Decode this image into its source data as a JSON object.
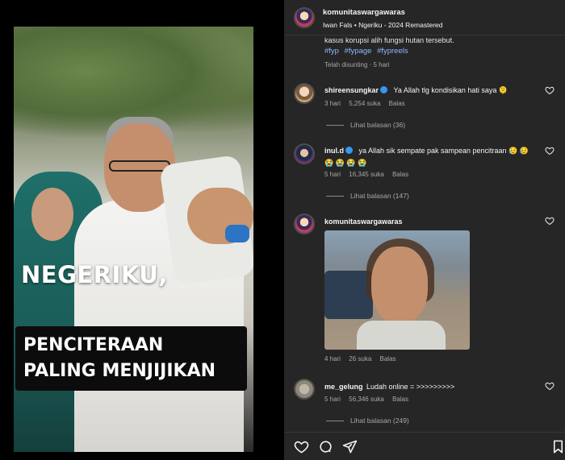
{
  "video": {
    "overlay_title": "NEGERIKU,",
    "overlay_line1": "PENCITERAAN",
    "overlay_line2": "PALING MENJIJIKAN"
  },
  "post": {
    "username": "komunitaswargawaras",
    "audio": "Iwan Fals • Ngeriku - 2024 Remastered",
    "caption_tail": "kasus korupsi alih fungsi hutan tersebut.",
    "tags": [
      "#fyp",
      "#fypage",
      "#fypreels"
    ],
    "edited_label": "Telah disunting · 5 hari"
  },
  "comments": [
    {
      "user": "shireensungkar",
      "verified": true,
      "text": "Ya Allah tlg kondisikan hati saya 🫠",
      "time": "3 hari",
      "likes": "5,254 suka",
      "reply": "Balas",
      "view_replies": "Lihat balasan (36)"
    },
    {
      "user": "inul.d",
      "verified": true,
      "text": "ya Allah sik sempate pak sampean pencitraan 😥 😥",
      "emoji_line": "😭 😭 😭 😭",
      "time": "5 hari",
      "likes": "16,345 suka",
      "reply": "Balas",
      "view_replies": "Lihat balasan (147)"
    },
    {
      "user": "komunitaswargawaras",
      "verified": false,
      "text": "",
      "time": "4 hari",
      "likes": "26 suka",
      "reply": "Balas"
    },
    {
      "user": "me_gelung",
      "verified": false,
      "text": "Ludah online = >>>>>>>>>",
      "time": "5 hari",
      "likes": "56,346 suka",
      "reply": "Balas",
      "view_replies": "Lihat balasan (249)"
    }
  ],
  "icons": {
    "like": "heart-icon",
    "comment": "comment-icon",
    "share": "send-icon",
    "save": "bookmark-icon"
  },
  "colors": {
    "panel_bg": "#262626",
    "link": "#8fb8ff",
    "verified": "#3897f0"
  }
}
